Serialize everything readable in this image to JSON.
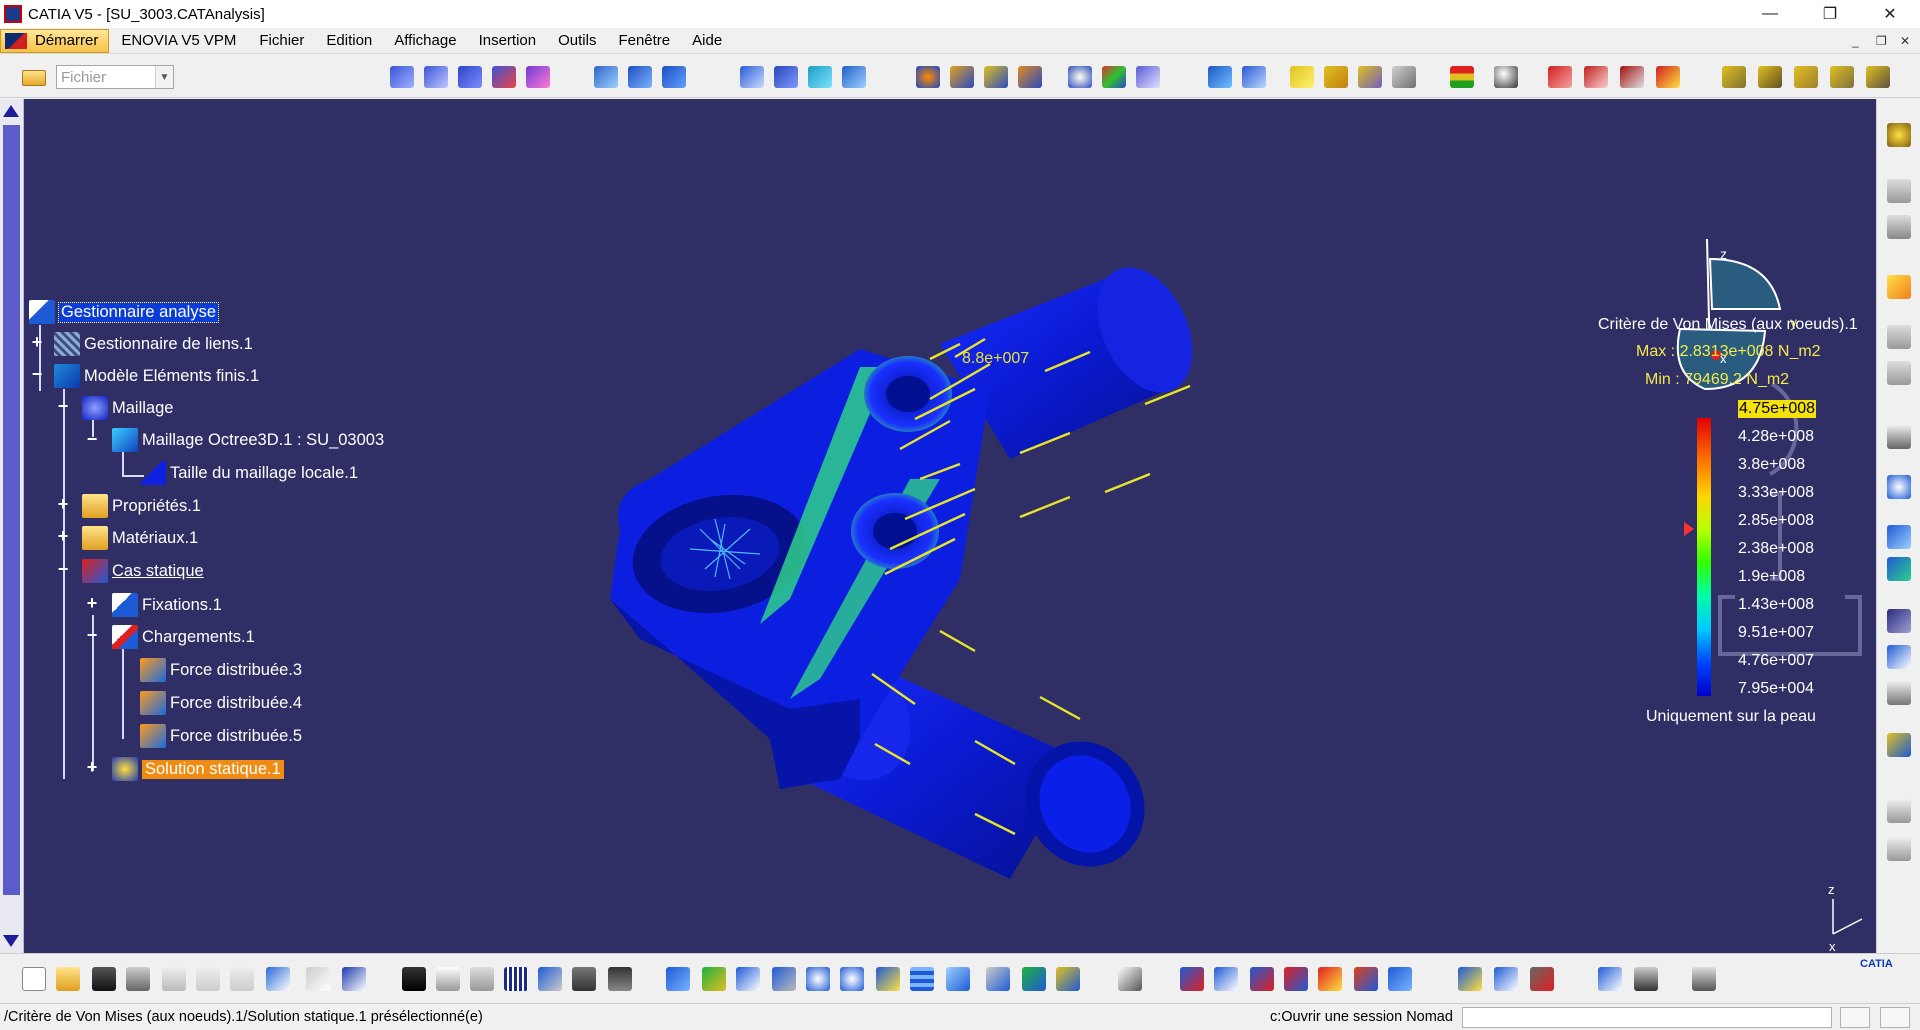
{
  "window": {
    "title": "CATIA V5 - [SU_3003.CATAnalysis]",
    "controls": {
      "minimize": "—",
      "maximize": "❐",
      "close": "✕"
    },
    "mdi_controls": {
      "minimize": "_",
      "restore": "❐",
      "close": "✕"
    }
  },
  "menu": {
    "start": "Démarrer",
    "enovia": "ENOVIA V5 VPM",
    "items": [
      "Fichier",
      "Edition",
      "Affichage",
      "Insertion",
      "Outils",
      "Fenêtre",
      "Aide"
    ]
  },
  "toolbar": {
    "workbench_combo": {
      "value": "Fichier",
      "arrow": "▼"
    }
  },
  "tree": {
    "nodes": [
      {
        "label": "Gestionnaire analyse",
        "icon": "analysis-manager-icon"
      },
      {
        "label": "Gestionnaire de liens.1",
        "icon": "links-manager-icon"
      },
      {
        "label": "Modèle Eléments finis.1",
        "icon": "fem-model-icon"
      },
      {
        "label": "Maillage",
        "icon": "mesh-icon"
      },
      {
        "label": "Maillage Octree3D.1 : SU_03003",
        "icon": "octree-mesh-icon"
      },
      {
        "label": "Taille du maillage locale.1",
        "icon": "local-mesh-size-icon"
      },
      {
        "label": "Propriétés.1",
        "icon": "folder-icon"
      },
      {
        "label": "Matériaux.1",
        "icon": "folder-icon"
      },
      {
        "label": "Cas statique",
        "icon": "static-case-icon"
      },
      {
        "label": "Fixations.1",
        "icon": "restraints-icon"
      },
      {
        "label": "Chargements.1",
        "icon": "loads-icon"
      },
      {
        "label": "Force distribuée.3",
        "icon": "distributed-force-icon"
      },
      {
        "label": "Force distribuée.4",
        "icon": "distributed-force-icon"
      },
      {
        "label": "Force distribuée.5",
        "icon": "distributed-force-icon"
      },
      {
        "label": "Solution statique.1",
        "icon": "static-solution-icon"
      }
    ],
    "expander_plus": "+",
    "expander_minus": "−"
  },
  "viewport": {
    "force_label": "8.8e+007",
    "compass": {
      "x": "x",
      "y": "y",
      "z": "z"
    },
    "mini_axes": {
      "x": "x",
      "z": "z"
    }
  },
  "legend": {
    "title": "Critère de Von Mises (aux noeuds).1",
    "max": "Max : 2.8313e+008 N_m2",
    "min": "Min : 79469.2 N_m2",
    "values": [
      "4.75e+008",
      "4.28e+008",
      "3.8e+008",
      "3.33e+008",
      "2.85e+008",
      "2.38e+008",
      "1.9e+008",
      "1.43e+008",
      "9.51e+007",
      "4.76e+007",
      "7.95e+004"
    ],
    "note": "Uniquement sur la peau",
    "colors": {
      "top": "#e00000",
      "bottom": "#0000cc",
      "highlight": "#f5e20a"
    }
  },
  "status": {
    "message": "/Critère de Von Mises (aux noeuds).1/Solution statique.1 présélectionné(e)",
    "command": "c:Ouvrir une session Nomad",
    "command_input": ""
  },
  "brand": {
    "logo_text": "CATIA"
  },
  "colors": {
    "viewport_bg": "#2f2f66",
    "part_blue": "#0a1ad0",
    "stress_green": "#2fd08a",
    "arrow_yellow": "#e7e52a",
    "selection": "#0a3cd8",
    "solution_highlight": "#f08c12"
  }
}
